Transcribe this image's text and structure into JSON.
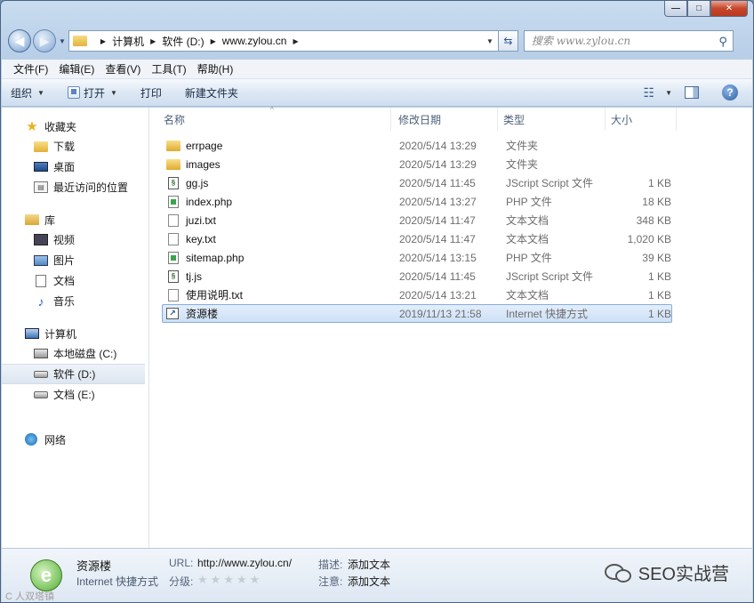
{
  "window": {
    "caption_buttons": [
      "minimize",
      "maximize",
      "close"
    ],
    "caption_glyphs": {
      "minimize": "—",
      "maximize": "□",
      "close": "✕"
    }
  },
  "address": {
    "crumbs": [
      "计算机",
      "软件 (D:)",
      "www.zylou.cn"
    ],
    "search_placeholder": "搜索 www.zylou.cn"
  },
  "menu": [
    "文件(F)",
    "编辑(E)",
    "查看(V)",
    "工具(T)",
    "帮助(H)"
  ],
  "toolbar": {
    "organize": "组织",
    "open": "打开",
    "print": "打印",
    "new_folder": "新建文件夹"
  },
  "nav": {
    "favorites": {
      "label": "收藏夹",
      "items": [
        "下载",
        "桌面",
        "最近访问的位置"
      ]
    },
    "libraries": {
      "label": "库",
      "items": [
        "视频",
        "图片",
        "文档",
        "音乐"
      ]
    },
    "computer": {
      "label": "计算机",
      "items": [
        "本地磁盘 (C:)",
        "软件 (D:)",
        "文档 (E:)"
      ]
    },
    "network": {
      "label": "网络"
    }
  },
  "columns": {
    "name": "名称",
    "date": "修改日期",
    "type": "类型",
    "size": "大小"
  },
  "files": [
    {
      "name": "errpage",
      "date": "2020/5/14 13:29",
      "type": "文件夹",
      "size": "",
      "icon": "folder"
    },
    {
      "name": "images",
      "date": "2020/5/14 13:29",
      "type": "文件夹",
      "size": "",
      "icon": "folder"
    },
    {
      "name": "gg.js",
      "date": "2020/5/14 11:45",
      "type": "JScript Script 文件",
      "size": "1 KB",
      "icon": "js"
    },
    {
      "name": "index.php",
      "date": "2020/5/14 13:27",
      "type": "PHP 文件",
      "size": "18 KB",
      "icon": "php"
    },
    {
      "name": "juzi.txt",
      "date": "2020/5/14 11:47",
      "type": "文本文档",
      "size": "348 KB",
      "icon": "txt"
    },
    {
      "name": "key.txt",
      "date": "2020/5/14 11:47",
      "type": "文本文档",
      "size": "1,020 KB",
      "icon": "txt"
    },
    {
      "name": "sitemap.php",
      "date": "2020/5/14 13:15",
      "type": "PHP 文件",
      "size": "39 KB",
      "icon": "php"
    },
    {
      "name": "tj.js",
      "date": "2020/5/14 11:45",
      "type": "JScript Script 文件",
      "size": "1 KB",
      "icon": "js"
    },
    {
      "name": "使用说明.txt",
      "date": "2020/5/14 13:21",
      "type": "文本文档",
      "size": "1 KB",
      "icon": "txt"
    },
    {
      "name": "资源楼",
      "date": "2019/11/13 21:58",
      "type": "Internet 快捷方式",
      "size": "1 KB",
      "icon": "url",
      "selected": true
    }
  ],
  "details": {
    "name": "资源楼",
    "type": "Internet 快捷方式",
    "url_label": "URL:",
    "url_value": "http://www.zylou.cn/",
    "rating_label": "分级:",
    "rating_stars": 0,
    "rating_max": 5,
    "desc_label": "描述:",
    "desc_value": "添加文本",
    "notes_label": "注意:",
    "notes_value": "添加文本"
  },
  "watermark": {
    "text": "SEO实战营"
  },
  "corner_mark": "C 人双塔镇"
}
